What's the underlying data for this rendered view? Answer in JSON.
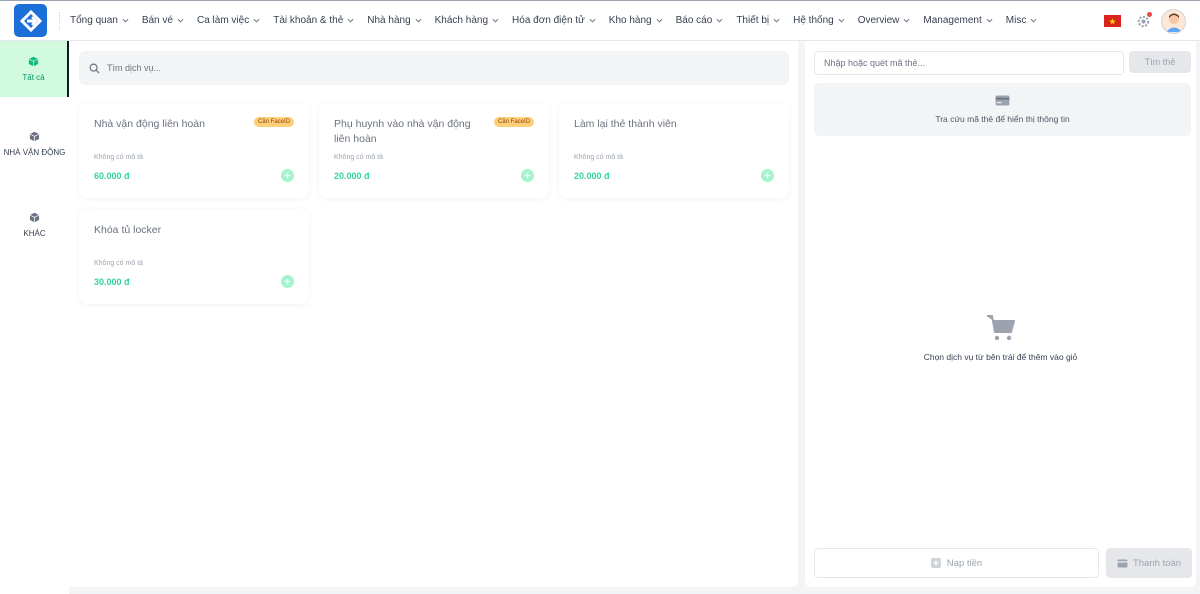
{
  "nav": {
    "items": [
      {
        "label": "Tổng quan"
      },
      {
        "label": "Bán vé"
      },
      {
        "label": "Ca làm việc"
      },
      {
        "label": "Tài khoản & thẻ"
      },
      {
        "label": "Nhà hàng"
      },
      {
        "label": "Khách hàng"
      },
      {
        "label": "Hóa đơn điện tử"
      },
      {
        "label": "Kho hàng"
      },
      {
        "label": "Báo cáo"
      },
      {
        "label": "Thiết bị"
      },
      {
        "label": "Hệ thống"
      },
      {
        "label": "Overview"
      },
      {
        "label": "Management"
      },
      {
        "label": "Misc"
      }
    ]
  },
  "categories": [
    {
      "label": "Tất cả",
      "active": true
    },
    {
      "label": "NHÀ VẬN ĐỘNG",
      "active": false
    },
    {
      "label": "KHÁC",
      "active": false
    }
  ],
  "search": {
    "placeholder": "Tìm dịch vụ..."
  },
  "services": [
    {
      "title": "Nhà vận động liên hoàn",
      "badge": "Cần FaceID",
      "description": "Không có mô tả",
      "price": "60.000 đ"
    },
    {
      "title": "Phụ huynh vào nhà vận động liên hoàn",
      "badge": "Cần FaceID",
      "description": "Không có mô tả",
      "price": "20.000 đ"
    },
    {
      "title": "Làm lại thẻ thành viên",
      "badge": "",
      "description": "Không có mô tả",
      "price": "20.000 đ"
    },
    {
      "title": "Khóa tủ locker",
      "badge": "",
      "description": "Không có mô tả",
      "price": "30.000 đ"
    }
  ],
  "panel": {
    "card_input_placeholder": "Nhập hoặc quét mã thẻ...",
    "find_button": "Tìm thẻ",
    "lookup_message": "Tra cứu mã thẻ để hiển thị thông tin",
    "empty_cart_message": "Chọn dịch vụ từ bên trái để thêm vào giỏ",
    "topup_button": "Nạp tiền",
    "pay_button": "Thanh toán"
  },
  "icons": {
    "logo": "logo-icon",
    "flag": "vietnam-flag-icon",
    "settings": "gear-icon",
    "avatar": "avatar-icon",
    "category": "cube-icon",
    "search": "search-icon",
    "add": "plus-circle-icon",
    "card": "credit-card-icon",
    "cart": "shopping-cart-icon",
    "wallet": "wallet-icon"
  },
  "colors": {
    "brand": "#1d6fd8",
    "accent_green": "#34d399",
    "active_bg": "#d1fadf",
    "badge": "#fcd079",
    "notification": "#ef4444"
  }
}
